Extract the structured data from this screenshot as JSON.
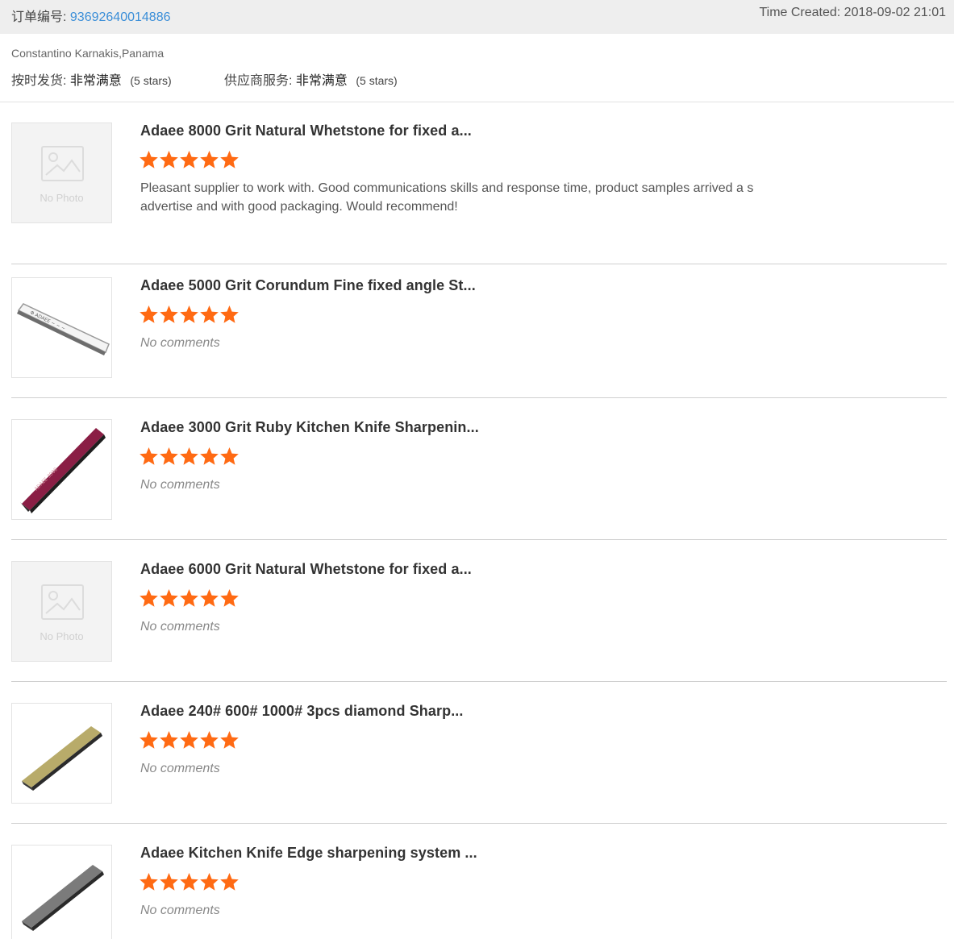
{
  "header": {
    "order_label": "订单编号:",
    "order_number": "93692640014886",
    "time_created": "Time Created: 2018-09-02 21:01"
  },
  "buyer": {
    "name": "Constantino Karnakis,Panama",
    "ratings": [
      {
        "label": "按时发货:",
        "value": "非常满意",
        "note": "(5 stars)"
      },
      {
        "label": "供应商服务:",
        "value": "非常满意",
        "note": "(5 stars)"
      }
    ]
  },
  "colors": {
    "star": "#ff6a13",
    "link": "#3a8ed8",
    "header_bg": "#eeeeee"
  },
  "items": [
    {
      "title": "Adaee 8000 Grit Natural Whetstone for fixed a...",
      "rating": 5,
      "comment": "Pleasant supplier to work with. Good communications skills and response time, product samples arrived a s advertise and with good packaging. Would recommend!",
      "has_comment": true,
      "thumb": "no-photo",
      "thumb_label": "No Photo"
    },
    {
      "title": "Adaee 5000 Grit Corundum Fine fixed angle St...",
      "rating": 5,
      "comment": "No comments",
      "has_comment": false,
      "thumb": "white-stone-icon"
    },
    {
      "title": "Adaee 3000 Grit Ruby Kitchen Knife Sharpenin...",
      "rating": 5,
      "comment": "No comments",
      "has_comment": false,
      "thumb": "red-stone-icon"
    },
    {
      "title": "Adaee 6000 Grit Natural Whetstone for fixed a...",
      "rating": 5,
      "comment": "No comments",
      "has_comment": false,
      "thumb": "no-photo",
      "thumb_label": "No Photo"
    },
    {
      "title": "Adaee 240# 600# 1000# 3pcs diamond Sharp...",
      "rating": 5,
      "comment": "No comments",
      "has_comment": false,
      "thumb": "gold-stone-icon"
    },
    {
      "title": "Adaee Kitchen Knife Edge sharpening system ...",
      "rating": 5,
      "comment": "No comments",
      "has_comment": false,
      "thumb": "gray-stone-icon"
    }
  ]
}
